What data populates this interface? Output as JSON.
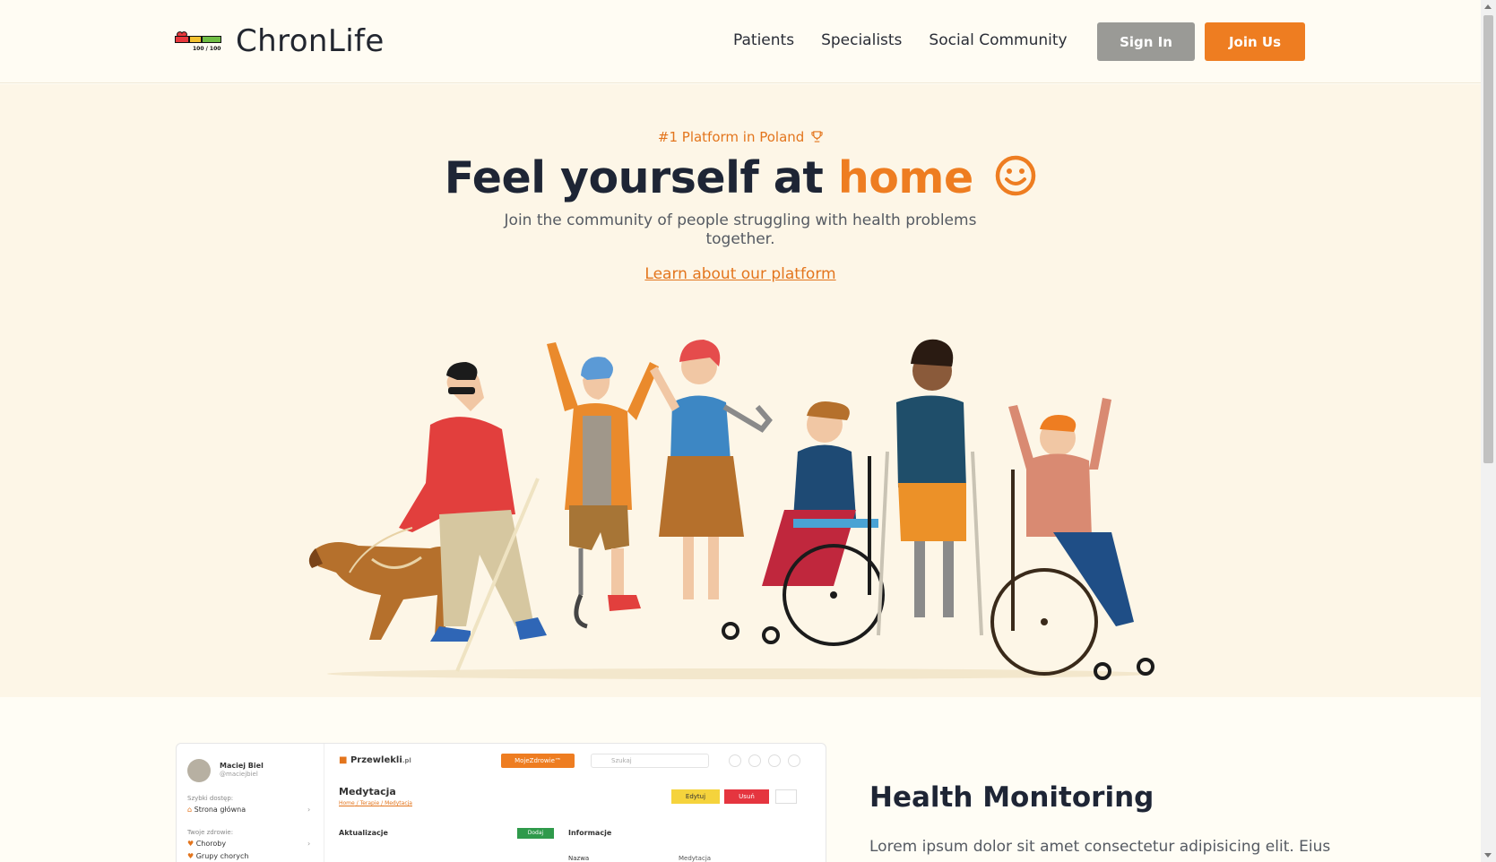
{
  "brand": {
    "name": "ChronLife",
    "score": "100 / 100"
  },
  "nav": {
    "patients": "Patients",
    "specialists": "Specialists",
    "community": "Social Community"
  },
  "auth": {
    "sign_in": "Sign In",
    "join": "Join Us"
  },
  "hero": {
    "badge": "#1 Platform in Poland",
    "headline_start": "Feel yourself at ",
    "headline_accent": "home",
    "subtext": "Join the community of people struggling with health problems together.",
    "learn_link": "Learn about our platform"
  },
  "mockup": {
    "user_name": "Maciej Biel",
    "user_handle": "@maciejbiel",
    "quick_access": "Szybki dostęp:",
    "home_item": "Strona główna",
    "your_health": "Twoje zdrowie:",
    "diseases": "Choroby",
    "groups": "Grupy chorych",
    "logo": "Przewlekli",
    "logo_suffix": ".pl",
    "app_button": "MojeZdrowie™",
    "search_placeholder": "Szukaj",
    "page_title": "Medytacja",
    "crumb_home": "Home",
    "crumb_therapies": "Terapie",
    "crumb_page": "Medytacja",
    "edit_button": "Edytuj",
    "delete_button": "Usuń",
    "updates_heading": "Aktualizacje",
    "add_button": "Dodaj",
    "info_heading": "Informacje",
    "name_label": "Nazwa",
    "name_value": "Medytacja"
  },
  "feature": {
    "title": "Health Monitoring",
    "text": "Lorem ipsum dolor sit amet consectetur adipisicing elit. Eius"
  },
  "colors": {
    "accent": "#ee7d21",
    "dark": "#1e2535",
    "hero_bg": "#fdf6e7",
    "sign_in": "#9a9a96"
  }
}
